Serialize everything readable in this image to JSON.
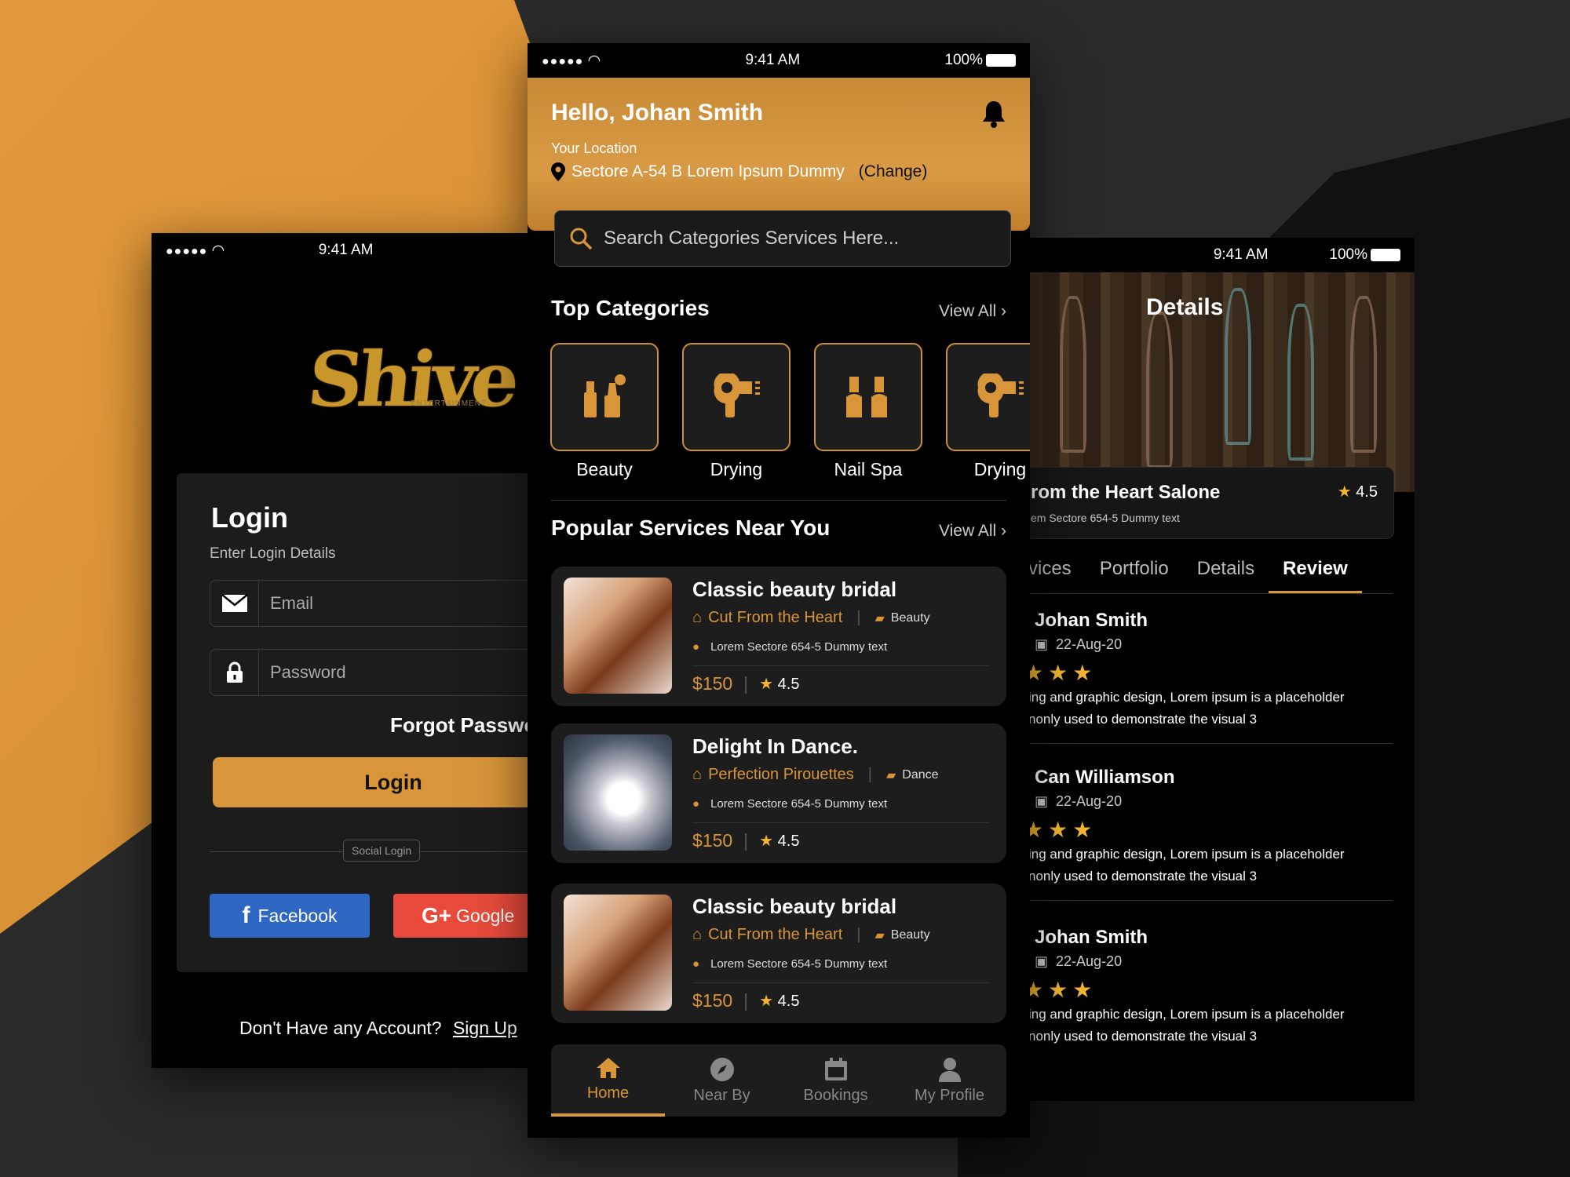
{
  "status": {
    "time": "9:41 AM",
    "battery": "100%"
  },
  "login": {
    "brand": "Shive",
    "brand_sub": "ENTERTAINMENT",
    "title": "Login",
    "subtitle": "Enter Login Details",
    "email_placeholder": "Email",
    "password_placeholder": "Password",
    "forgot": "Forgot Password",
    "button": "Login",
    "social_label": "Social Login",
    "facebook": "Facebook",
    "google": "Google",
    "no_account": "Don't Have any Account?",
    "signup": "Sign Up"
  },
  "home": {
    "greeting": "Hello, Johan Smith",
    "location_label": "Your Location",
    "location": "Sectore A-54 B Lorem Ipsum Dummy",
    "change": "(Change)",
    "search_placeholder": "Search Categories Services Here...",
    "top_categories": "Top Categories",
    "popular": "Popular Services Near You",
    "view_all": "View All",
    "categories": [
      {
        "label": "Beauty",
        "icon": "makeup-icon"
      },
      {
        "label": "Drying",
        "icon": "hair-dryer-icon"
      },
      {
        "label": "Nail Spa",
        "icon": "nail-polish-icon"
      },
      {
        "label": "Drying",
        "icon": "hair-dryer-icon"
      }
    ],
    "services": [
      {
        "title": "Classic beauty bridal",
        "shop": "Cut From the Heart",
        "category": "Beauty",
        "address": "Lorem Sectore 654-5 Dummy text",
        "price": "$150",
        "rating": "4.5"
      },
      {
        "title": "Delight In Dance.",
        "shop": "Perfection Pirouettes",
        "category": "Dance",
        "address": "Lorem Sectore 654-5 Dummy text",
        "price": "$150",
        "rating": "4.5"
      },
      {
        "title": "Classic beauty bridal",
        "shop": "Cut From the Heart",
        "category": "Beauty",
        "address": "Lorem Sectore 654-5 Dummy text",
        "price": "$150",
        "rating": "4.5"
      }
    ],
    "tabs": [
      {
        "label": "Home",
        "icon": "home-icon",
        "active": true
      },
      {
        "label": "Near By",
        "icon": "compass-icon"
      },
      {
        "label": "Bookings",
        "icon": "calendar-icon"
      },
      {
        "label": "My Profile",
        "icon": "profile-icon"
      }
    ]
  },
  "details": {
    "title": "Details",
    "salon_name": "rom the Heart Salone",
    "salon_rating": "4.5",
    "salon_address": "em Sectore 654-5 Dummy text",
    "tabs": [
      "vices",
      "Portfolio",
      "Details",
      "Review"
    ],
    "active_tab": "Review",
    "reviews": [
      {
        "name": "Johan Smith",
        "date": "22-Aug-20",
        "stars": 3,
        "line1": "ing and graphic design, Lorem ipsum is a placeholder",
        "line2": "nonly used to demonstrate the visual 3"
      },
      {
        "name": "Can Williamson",
        "date": "22-Aug-20",
        "stars": 3,
        "line1": "ing and graphic design, Lorem ipsum is a placeholder",
        "line2": "nonly used to demonstrate the visual 3"
      },
      {
        "name": "Johan Smith",
        "date": "22-Aug-20",
        "stars": 3,
        "line1": "ing and graphic design, Lorem ipsum is a placeholder",
        "line2": "nonly used to demonstrate the visual 3"
      }
    ]
  },
  "colors": {
    "accent": "#d8953a",
    "background": "#000000",
    "card": "#1d1d1d",
    "star": "#f2b632"
  }
}
